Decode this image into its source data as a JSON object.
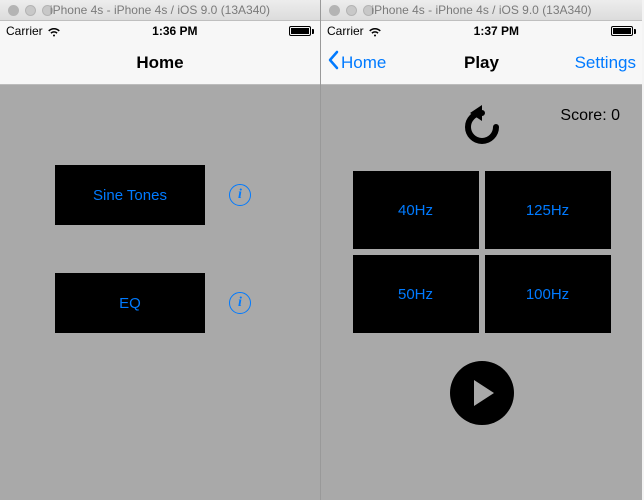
{
  "left": {
    "mac_title": "iPhone 4s - iPhone 4s / iOS 9.0 (13A340)",
    "carrier": "Carrier",
    "time": "1:36 PM",
    "nav_title": "Home",
    "buttons": {
      "sine": "Sine Tones",
      "eq": "EQ"
    },
    "info_glyph": "i"
  },
  "right": {
    "mac_title": "iPhone 4s - iPhone 4s / iOS 9.0 (13A340)",
    "carrier": "Carrier",
    "time": "1:37 PM",
    "nav_back": "Home",
    "nav_title": "Play",
    "nav_right": "Settings",
    "score_label": "Score: 0",
    "grid": [
      "40Hz",
      "125Hz",
      "50Hz",
      "100Hz"
    ]
  }
}
